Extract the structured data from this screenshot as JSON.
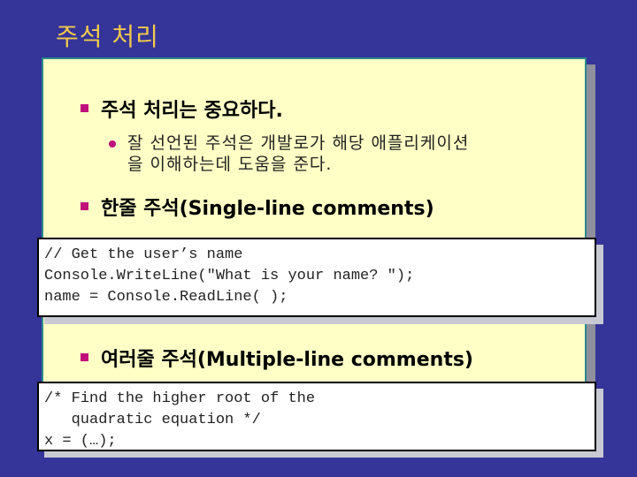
{
  "slide": {
    "title": "주석 처리",
    "colors": {
      "background": "#343499",
      "title": "#f2c94c",
      "panel": "#ffffc6",
      "bullet": "#c0107a",
      "code_bg": "#ffffff"
    },
    "bullets": [
      {
        "text": "주석 처리는 중요하다.",
        "sub_bullets": [
          {
            "line1": "잘 선언된 주석은 개발로가 해당 애플리케이션",
            "line2": "을 이해하는데 도움을 준다."
          }
        ]
      },
      {
        "text": "한줄 주석(Single-line comments)",
        "code": [
          "// Get the user’s name",
          "Console.WriteLine(\"What is your name? \");",
          "name = Console.ReadLine( );"
        ]
      },
      {
        "text": "여러줄 주석(Multiple-line comments)",
        "code": [
          "/* Find the higher root of the",
          "   quadratic equation */",
          "x = (…);"
        ]
      }
    ]
  }
}
